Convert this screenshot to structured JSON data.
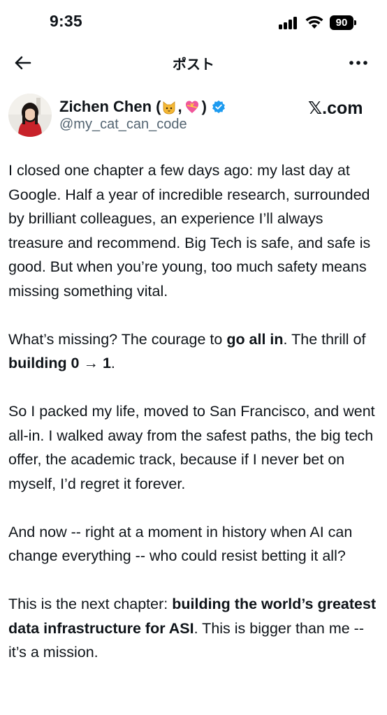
{
  "status_bar": {
    "time": "9:35",
    "battery": "90"
  },
  "header": {
    "title": "ポスト"
  },
  "author": {
    "name": "Zichen Chen (",
    "name_sep": ",",
    "name_close": ")",
    "name_emojis": [
      "cat-face-emoji",
      "heart-with-ribbon-emoji"
    ],
    "handle": "@my_cat_can_code",
    "verified": true
  },
  "brand": "𝕏.com",
  "post": {
    "p1": "I closed one chapter a few days ago: my last day at Google. Half a year of incredible research, surrounded by brilliant colleagues, an experience I’ll always treasure and recommend. Big Tech is safe, and safe is good. But when you’re young, too much safety means missing something vital.",
    "p2_a": "What’s missing? The courage to ",
    "p2_b": "go all in",
    "p2_c": ". The thrill of ",
    "p2_d": "building 0 → 1",
    "p2_e": ".",
    "p3": "So I packed my life, moved to San Francisco, and went all-in. I walked away from the safest paths, the big tech offer, the academic track, because if I never bet on myself, I’d regret it forever.",
    "p4": "And now -- right at a moment in history when AI can change everything -- who could resist betting it all?",
    "p5_a": "This is the next chapter: ",
    "p5_b": "building the world’s greatest data infrastructure for ASI",
    "p5_c": ". This is bigger than me -- it’s a mission."
  },
  "colors": {
    "text": "#0f1419",
    "secondary": "#536471",
    "verified": "#1d9bf0"
  },
  "icons": [
    "back-arrow-icon",
    "more-icon",
    "verified-badge-icon",
    "wifi-icon",
    "signal-icon"
  ]
}
